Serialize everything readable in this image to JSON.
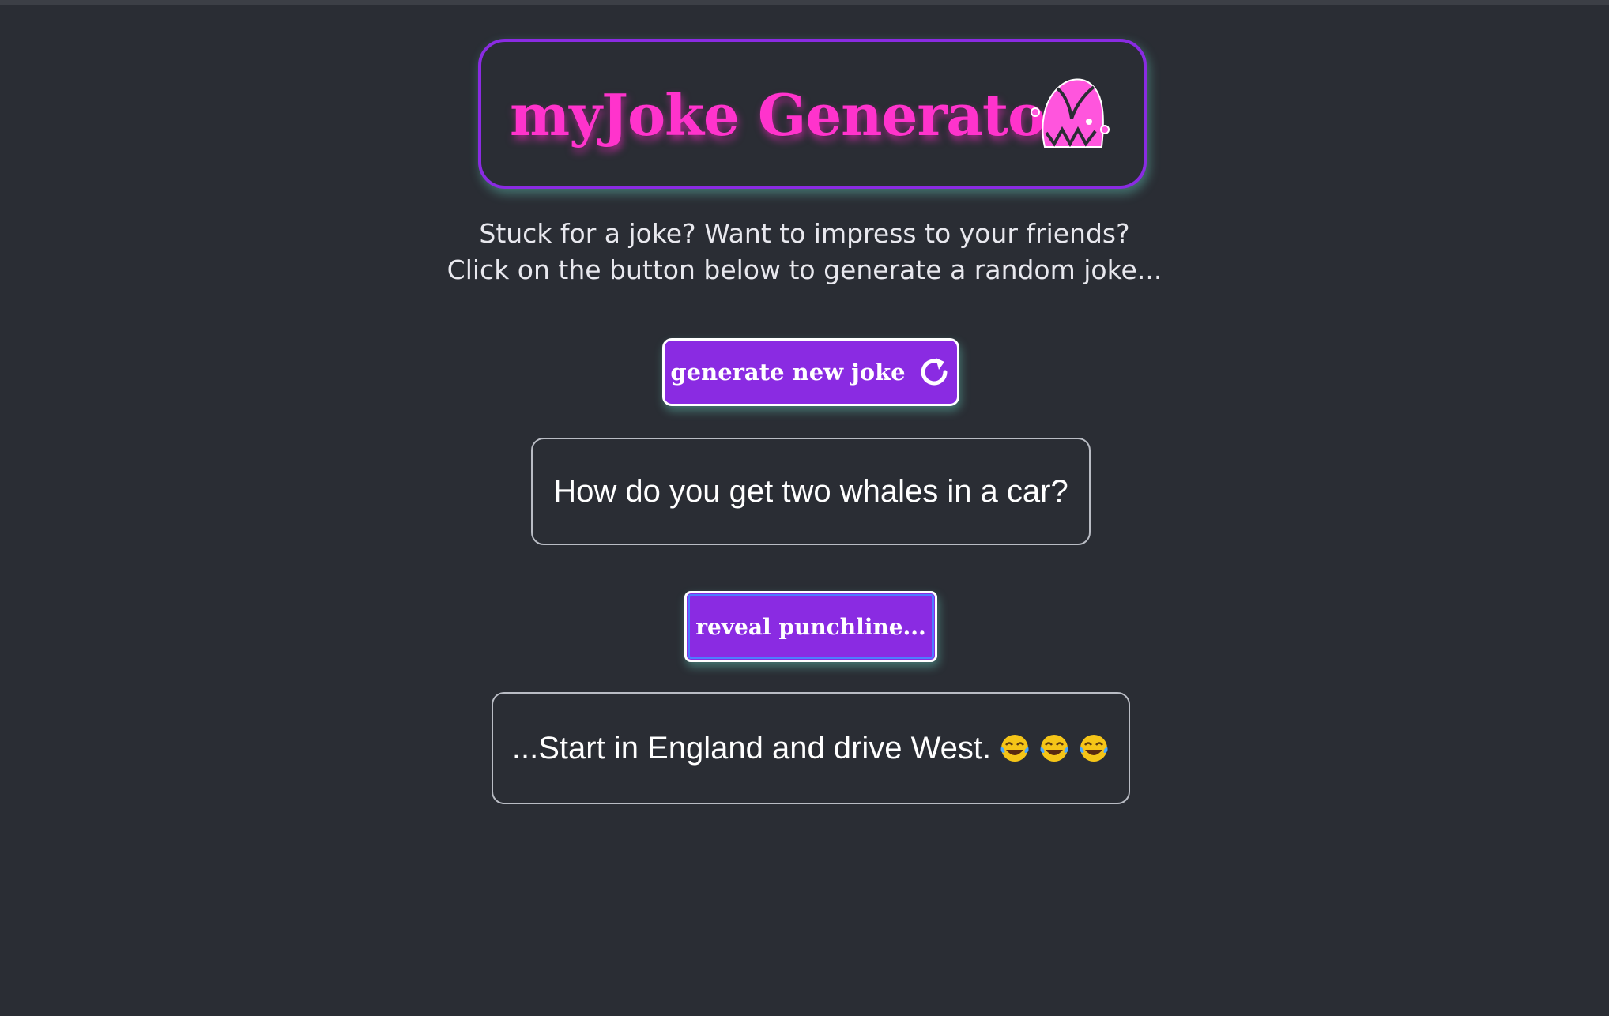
{
  "header": {
    "title": "myJoke Generator",
    "icon": "jester-hat-icon",
    "title_color": "#ff33cc",
    "border_color": "#8a2be2"
  },
  "intro": {
    "line1": "Stuck for a joke? Want to impress to your friends?",
    "line2": "Click on the button below to generate a random joke..."
  },
  "buttons": {
    "generate_label": "generate new joke",
    "generate_icon": "refresh-icon",
    "reveal_label": "reveal punchline..."
  },
  "joke": {
    "setup": "How do you get two whales in a car?",
    "punchline": "...Start in England and drive West.",
    "punchline_emoji": "laughing-tears-emoji",
    "emoji_count": 3
  },
  "colors": {
    "background": "#2a2d34",
    "accent": "#8a2be2",
    "text": "#ffffff"
  }
}
